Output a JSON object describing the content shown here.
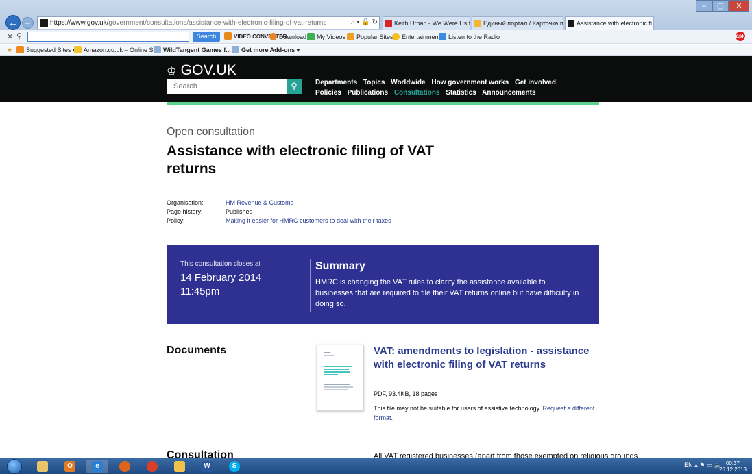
{
  "browser": {
    "url_prefix": "https://www.gov.uk/",
    "url_rest": "government/consultations/assistance-with-electronic-filing-of-vat-returns",
    "tabs": [
      {
        "label": "Keith Urban - We Were Us ft. ..."
      },
      {
        "label": "Единый портал / Карточка пр..."
      },
      {
        "label": "Assistance with electronic fi..."
      }
    ],
    "toolbar": {
      "search_button": "Search",
      "items": [
        "Download",
        "My Videos",
        "Popular Sites",
        "Entertainment",
        "Listen to the Radio"
      ],
      "converter_label": "VIDEO CONVERTER"
    },
    "favorites": [
      "Suggested Sites ▾",
      "Amazon.co.uk – Online S...",
      "WildTangent Games f...",
      "Get more Add-ons ▾"
    ]
  },
  "header": {
    "logo_text": "GOV.UK",
    "search_placeholder": "Search",
    "nav_row1": [
      "Departments",
      "Topics",
      "Worldwide",
      "How government works",
      "Get involved"
    ],
    "nav_row2": [
      "Policies",
      "Publications",
      "Consultations",
      "Statistics",
      "Announcements"
    ]
  },
  "page": {
    "kicker": "Open consultation",
    "title": "Assistance with electronic filing of VAT returns",
    "meta": [
      {
        "label": "Organisation:",
        "value": "HM Revenue & Customs"
      },
      {
        "label": "Page history:",
        "value": "Published"
      },
      {
        "label": "Policy:",
        "value": "Making it easier for HMRC customers to deal with their taxes"
      }
    ],
    "panel": {
      "closes_label": "This consultation closes at",
      "date": "14 February 2014",
      "time": "11:45pm",
      "summary_heading": "Summary",
      "summary_text": "HMRC is changing the VAT rules to clarify the assistance available to businesses that are required to file their VAT returns online but have difficulty in doing so."
    },
    "documents_heading": "Documents",
    "document": {
      "title": "VAT: amendments to legislation - assistance with electronic filing of VAT returns",
      "info": "PDF, 93.4KB, 18 pages",
      "note": "This file may not be suitable for users of assistive technology.",
      "request_link": "Request a different format."
    },
    "consultation_heading": "Consultation",
    "consultation_text": "All VAT registered businesses (apart from those exempted on religious grounds"
  },
  "taskbar": {
    "lang": "EN",
    "time": "00:37",
    "date": "26.12.2013"
  },
  "colors": {
    "gov_black": "#0b0c0c",
    "gov_green": "#5fd18f",
    "teal": "#28a197",
    "panel_blue": "#2e3192",
    "link_blue": "#2b3b8f"
  }
}
